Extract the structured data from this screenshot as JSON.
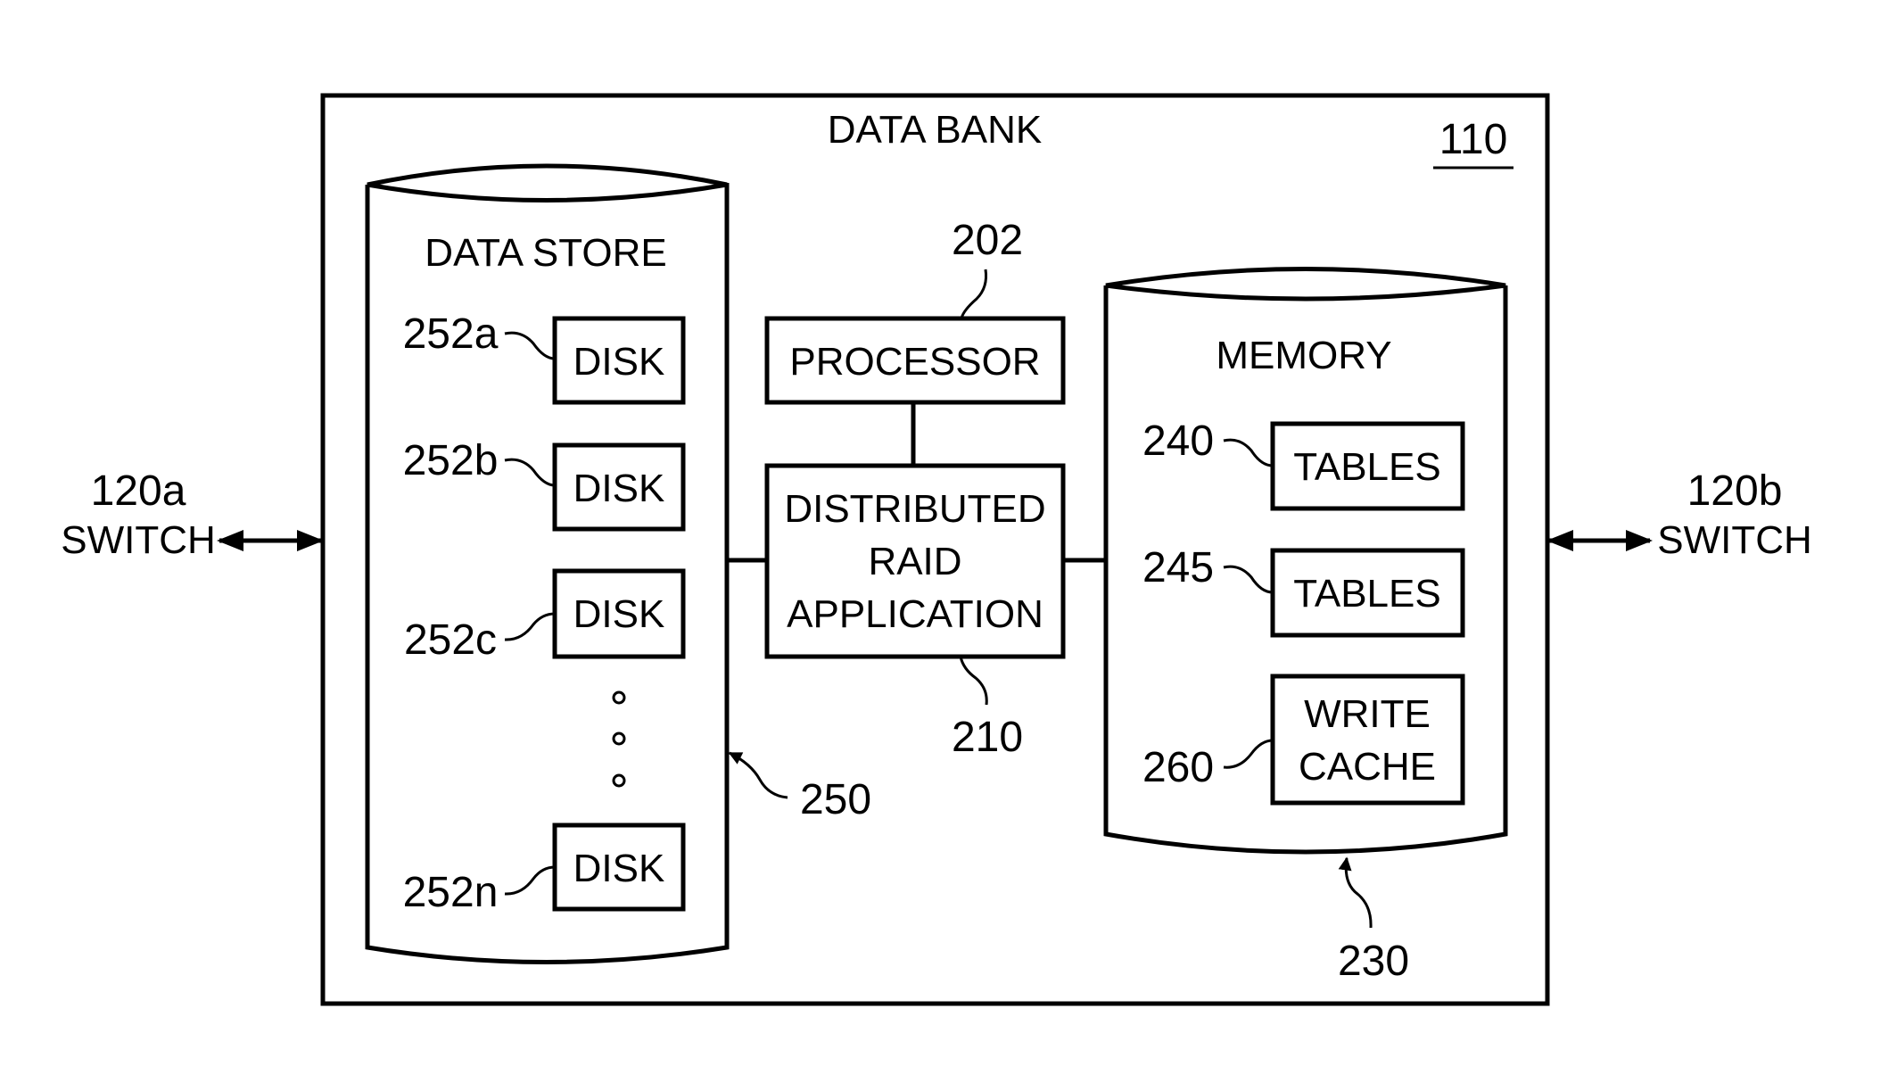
{
  "diagram": {
    "container": {
      "title": "DATA BANK",
      "ref": "110"
    },
    "switches": [
      {
        "id": "left",
        "ref": "120a",
        "label": "SWITCH"
      },
      {
        "id": "right",
        "ref": "120b",
        "label": "SWITCH"
      }
    ],
    "data_store": {
      "title": "DATA STORE",
      "ref": "250",
      "disks": [
        {
          "ref": "252a",
          "label": "DISK"
        },
        {
          "ref": "252b",
          "label": "DISK"
        },
        {
          "ref": "252c",
          "label": "DISK"
        },
        {
          "ref": "252n",
          "label": "DISK"
        }
      ],
      "ellipsis": "vertical-dots"
    },
    "processor": {
      "label": "PROCESSOR",
      "ref": "202"
    },
    "raid_app": {
      "lines": [
        "DISTRIBUTED",
        "RAID",
        "APPLICATION"
      ],
      "ref": "210"
    },
    "memory": {
      "title": "MEMORY",
      "ref": "230",
      "items": [
        {
          "ref": "240",
          "lines": [
            "TABLES"
          ]
        },
        {
          "ref": "245",
          "lines": [
            "TABLES"
          ]
        },
        {
          "ref": "260",
          "lines": [
            "WRITE",
            "CACHE"
          ]
        }
      ]
    },
    "connections": [
      "switch-120a <-> data-bank",
      "data-bank <-> switch-120b",
      "processor - raid-application",
      "data-store - raid-application",
      "raid-application - memory"
    ]
  }
}
